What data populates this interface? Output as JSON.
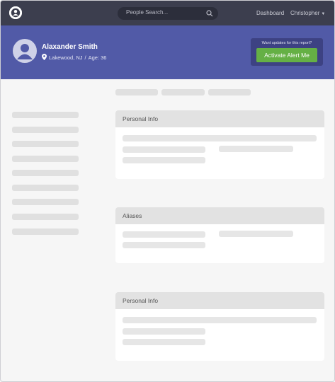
{
  "nav": {
    "search_placeholder": "People Search...",
    "dashboard_label": "Dashboard",
    "user_label": "Christopher",
    "user_caret": "▼"
  },
  "profile": {
    "name": "Alaxander Smith",
    "location": "Lakewood, NJ",
    "separator": "/",
    "age_label": "Age: 36"
  },
  "alert": {
    "caption": "Want updates for this report?",
    "button_label": "Activate Alert Me"
  },
  "sections": [
    {
      "title": "Personal Info"
    },
    {
      "title": "Aliases"
    },
    {
      "title": "Personal Info"
    }
  ],
  "colors": {
    "nav_bg": "#3c3e4e",
    "header_bg": "#515aa7",
    "alert_button": "#65b045",
    "page_bg": "#f6f6f6",
    "skeleton": "#e0e0e0"
  }
}
